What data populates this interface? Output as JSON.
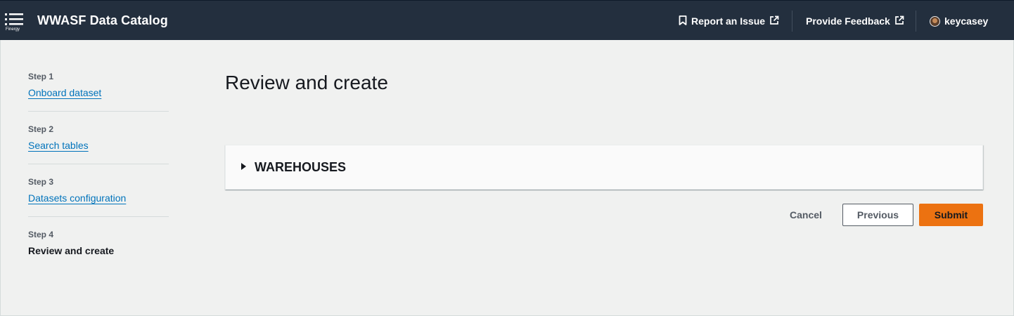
{
  "app": {
    "title": "WWASF Data Catalog",
    "menu_sub_label": "Finergy"
  },
  "header": {
    "report_issue": "Report an Issue",
    "provide_feedback": "Provide Feedback",
    "username": "keycasey"
  },
  "steps": [
    {
      "num": "Step 1",
      "label": "Onboard dataset"
    },
    {
      "num": "Step 2",
      "label": "Search tables"
    },
    {
      "num": "Step 3",
      "label": "Datasets configuration"
    },
    {
      "num": "Step 4",
      "label": "Review and create"
    }
  ],
  "main": {
    "title": "Review and create",
    "section_title": "WAREHOUSES"
  },
  "actions": {
    "cancel": "Cancel",
    "previous": "Previous",
    "submit": "Submit"
  },
  "colors": {
    "nav_bg": "#232f3e",
    "link": "#0073bb",
    "primary": "#ec7211",
    "page_bg": "#f0f1f0"
  },
  "icons": {
    "menu": "menu-icon",
    "report": "bookmark-icon",
    "external": "external-link-icon",
    "user": "avatar"
  }
}
